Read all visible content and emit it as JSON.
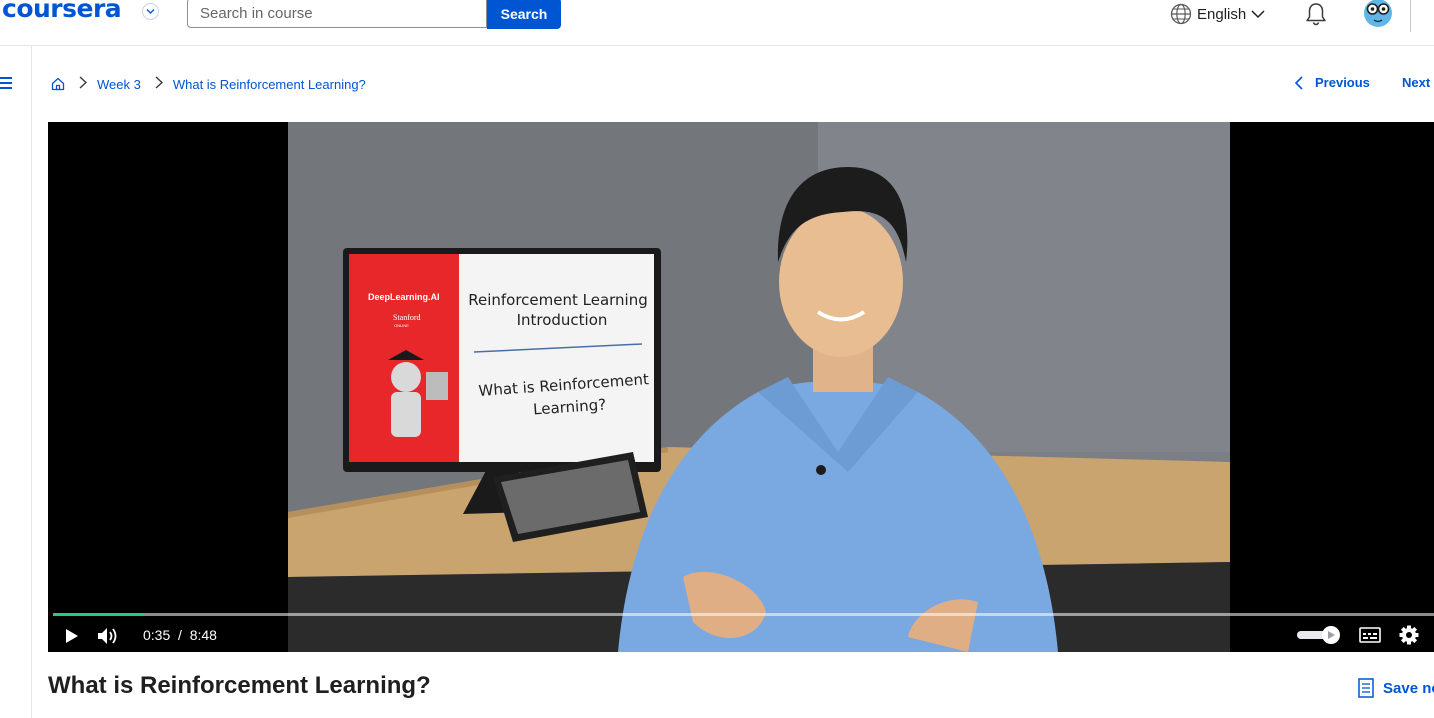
{
  "header": {
    "logo": "coursera",
    "search": {
      "placeholder": "Search in course",
      "value": ""
    },
    "search_button": "Search",
    "language": "English"
  },
  "breadcrumb": {
    "home_icon": "home-icon",
    "items": [
      "Week 3",
      "What is Reinforcement Learning?"
    ]
  },
  "nav": {
    "previous": "Previous",
    "next": "Next"
  },
  "video": {
    "slide": {
      "brand": "DeepLearning.AI",
      "partner": "Stanford",
      "partner_sub": "ONLINE",
      "title_line1": "Reinforcement Learning",
      "title_line2": "Introduction",
      "subtitle_line1": "What is Reinforcement",
      "subtitle_line2": "Learning?"
    },
    "current_time": "0:35",
    "time_separator": "/",
    "duration": "8:48",
    "progress_fraction": 0.066,
    "volume_fraction": 0.75
  },
  "content": {
    "title": "What is Reinforcement Learning?",
    "save_note": "Save note"
  },
  "colors": {
    "brand": "#0056d2",
    "progress": "#2dc97e",
    "slide_red": "#e8272b"
  }
}
